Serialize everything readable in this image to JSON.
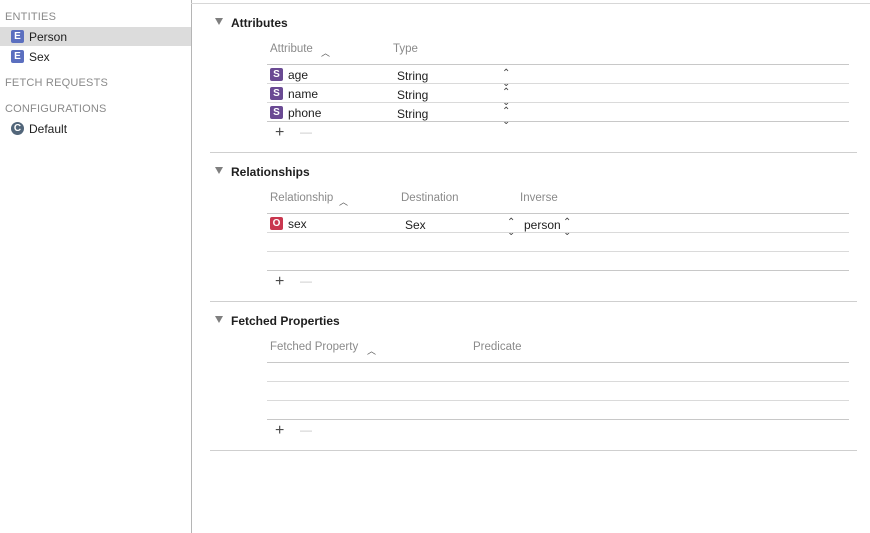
{
  "sidebar": {
    "entities_header": "ENTITIES",
    "entities": [
      {
        "badge": "E",
        "label": "Person",
        "selected": true
      },
      {
        "badge": "E",
        "label": "Sex",
        "selected": false
      }
    ],
    "fetch_requests_header": "FETCH REQUESTS",
    "configurations_header": "CONFIGURATIONS",
    "configurations": [
      {
        "badge": "C",
        "label": "Default"
      }
    ]
  },
  "attributes": {
    "title": "Attributes",
    "col_attribute": "Attribute",
    "col_type": "Type",
    "rows": [
      {
        "badge": "S",
        "name": "age",
        "type": "String"
      },
      {
        "badge": "S",
        "name": "name",
        "type": "String"
      },
      {
        "badge": "S",
        "name": "phone",
        "type": "String"
      }
    ],
    "add_label": "+",
    "remove_label": "—"
  },
  "relationships": {
    "title": "Relationships",
    "col_relationship": "Relationship",
    "col_destination": "Destination",
    "col_inverse": "Inverse",
    "rows": [
      {
        "badge": "O",
        "name": "sex",
        "destination": "Sex",
        "inverse": "person"
      }
    ],
    "add_label": "+",
    "remove_label": "—"
  },
  "fetched_properties": {
    "title": "Fetched Properties",
    "col_fetched_property": "Fetched Property",
    "col_predicate": "Predicate",
    "add_label": "+",
    "remove_label": "—"
  },
  "icons": {
    "sort_ascending": "^",
    "stepper": "⌃⌄",
    "disclosure": "▼"
  },
  "colors": {
    "entity_badge": "#5b6fbf",
    "string_badge": "#6a4a93",
    "relationship_badge": "#c9374f",
    "config_badge": "#52667a",
    "selection": "#dcdcdc"
  }
}
